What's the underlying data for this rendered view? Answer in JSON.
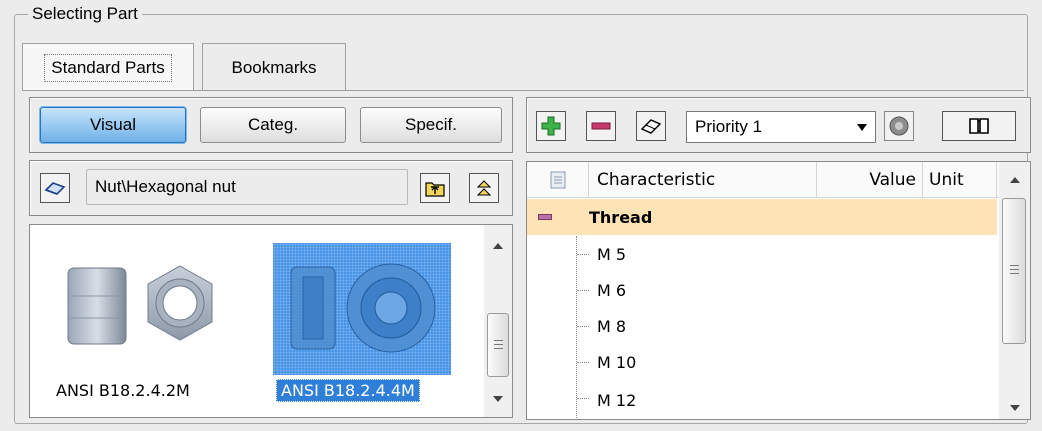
{
  "group": {
    "title": "Selecting Part"
  },
  "tabs": [
    {
      "label": "Standard Parts",
      "active": true
    },
    {
      "label": "Bookmarks",
      "active": false
    }
  ],
  "view_buttons": [
    {
      "label": "Visual",
      "active": true
    },
    {
      "label": "Categ.",
      "active": false
    },
    {
      "label": "Specif.",
      "active": false
    }
  ],
  "path": {
    "value": "Nut\\Hexagonal nut"
  },
  "thumbnails": [
    {
      "caption": "ANSI B18.2.4.2M",
      "selected": false
    },
    {
      "caption": "ANSI B18.2.4.4M",
      "selected": true
    }
  ],
  "toolbar": {
    "add_icon": "plus-icon",
    "remove_icon": "minus-icon",
    "erase_icon": "eraser-icon",
    "priority_value": "Priority 1",
    "extra_icon": "disc-icon",
    "book_icon": "book-icon"
  },
  "table": {
    "headers": {
      "characteristic": "Characteristic",
      "value": "Value",
      "unit": "Unit"
    },
    "group_row": "Thread",
    "rows": [
      "M 5",
      "M 6",
      "M 8",
      "M 10",
      "M 12"
    ]
  },
  "colors": {
    "selection": "#3d8ee6",
    "group_row": "#fde3b6",
    "accent_button": "#6fb1e8"
  }
}
